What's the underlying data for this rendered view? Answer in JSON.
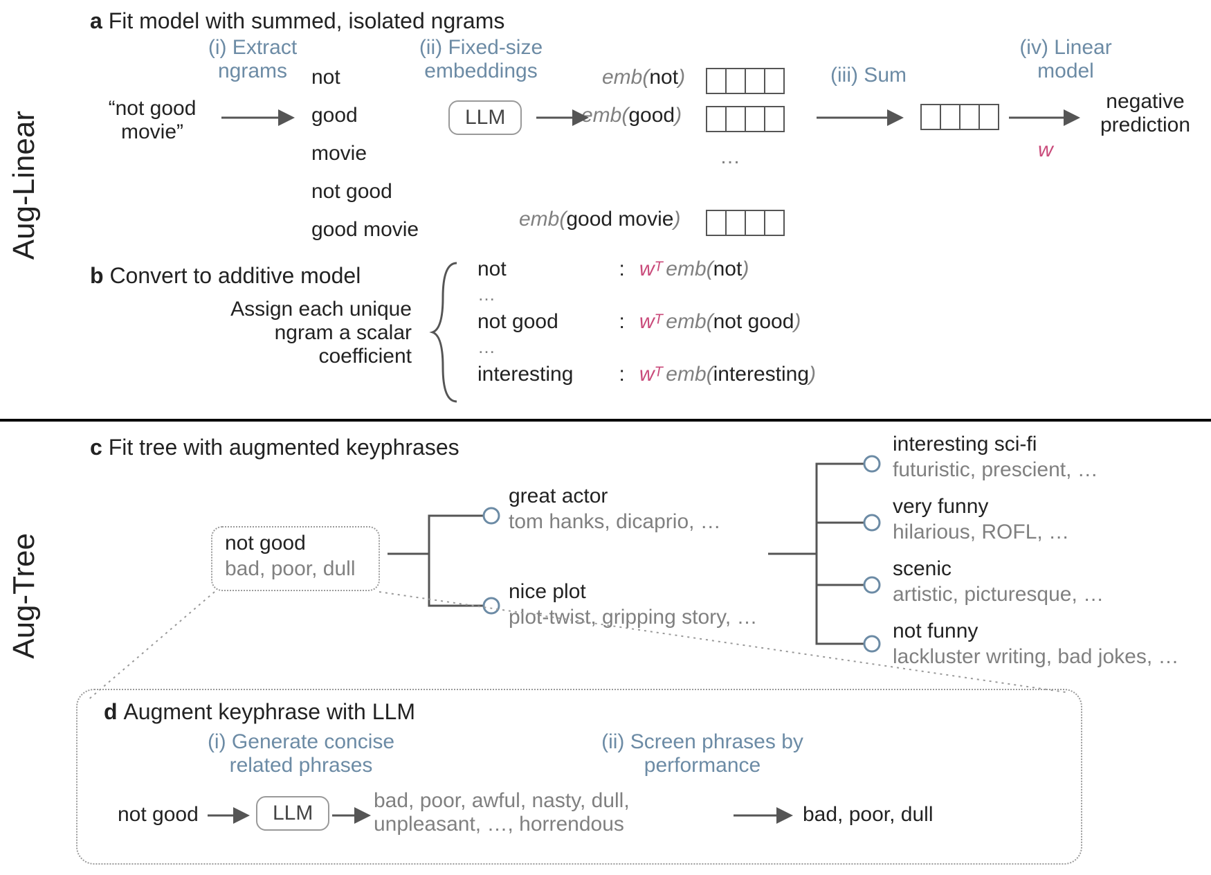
{
  "labels": {
    "aug_linear": "Aug-Linear",
    "aug_tree": "Aug-Tree"
  },
  "a": {
    "title_bold": "a ",
    "title": "Fit model with summed, isolated ngrams",
    "step1": "(i) Extract ngrams",
    "step2": "(ii) Fixed-size embeddings",
    "step3": "(iii) Sum",
    "step4": "(iv) Linear model",
    "input": "“not good movie”",
    "ngrams": [
      "not",
      "good",
      "movie",
      "not good",
      "good movie"
    ],
    "llm": "LLM",
    "emb1_pre": "emb(",
    "emb1_arg": "not",
    "emb1_post": ")",
    "emb2_pre": "emb(",
    "emb2_arg": "good",
    "emb2_post": ")",
    "emb3_pre": "emb(",
    "emb3_arg": "good movie",
    "emb3_post": ")",
    "dots": "…",
    "w": "w",
    "output": "negative prediction"
  },
  "b": {
    "title_bold": "b ",
    "title": "Convert to additive model",
    "sub": "Assign each unique ngram a scalar coefficient",
    "rows": [
      {
        "ng": "not",
        "wt": "w",
        "T": "T",
        "emb": " emb(",
        "arg": "not",
        "post": ")"
      },
      {
        "ng": "…",
        "wt": "",
        "T": "",
        "emb": "",
        "arg": "",
        "post": ""
      },
      {
        "ng": "not good",
        "wt": "w",
        "T": "T",
        "emb": " emb(",
        "arg": "not good",
        "post": ")"
      },
      {
        "ng": "…",
        "wt": "",
        "T": "",
        "emb": "",
        "arg": "",
        "post": ""
      },
      {
        "ng": "interesting",
        "wt": "w",
        "T": "T",
        "emb": " emb(",
        "arg": "interesting",
        "post": ")"
      }
    ]
  },
  "c": {
    "title_bold": "c ",
    "title": "Fit tree with augmented keyphrases",
    "root": {
      "kp": "not good",
      "exp": "bad, poor, dull"
    },
    "l2": [
      {
        "kp": "great actor",
        "exp": "tom hanks, dicaprio, …"
      },
      {
        "kp": "nice plot",
        "exp": "plot-twist, gripping story, …"
      }
    ],
    "l3": [
      {
        "kp": "interesting sci-fi",
        "exp": "futuristic, prescient, …"
      },
      {
        "kp": "very funny",
        "exp": "hilarious, ROFL, …"
      },
      {
        "kp": "scenic",
        "exp": "artistic, picturesque, …"
      },
      {
        "kp": "not funny",
        "exp": "lackluster writing, bad jokes, …"
      }
    ]
  },
  "d": {
    "title_bold": "d ",
    "title": "Augment keyphrase with LLM",
    "step1": "(i) Generate concise related phrases",
    "step2": "(ii) Screen phrases by performance",
    "input": "not good",
    "llm": "LLM",
    "gen": "bad, poor, awful, nasty, dull, unpleasant, …, horrendous",
    "out": "bad, poor, dull"
  }
}
